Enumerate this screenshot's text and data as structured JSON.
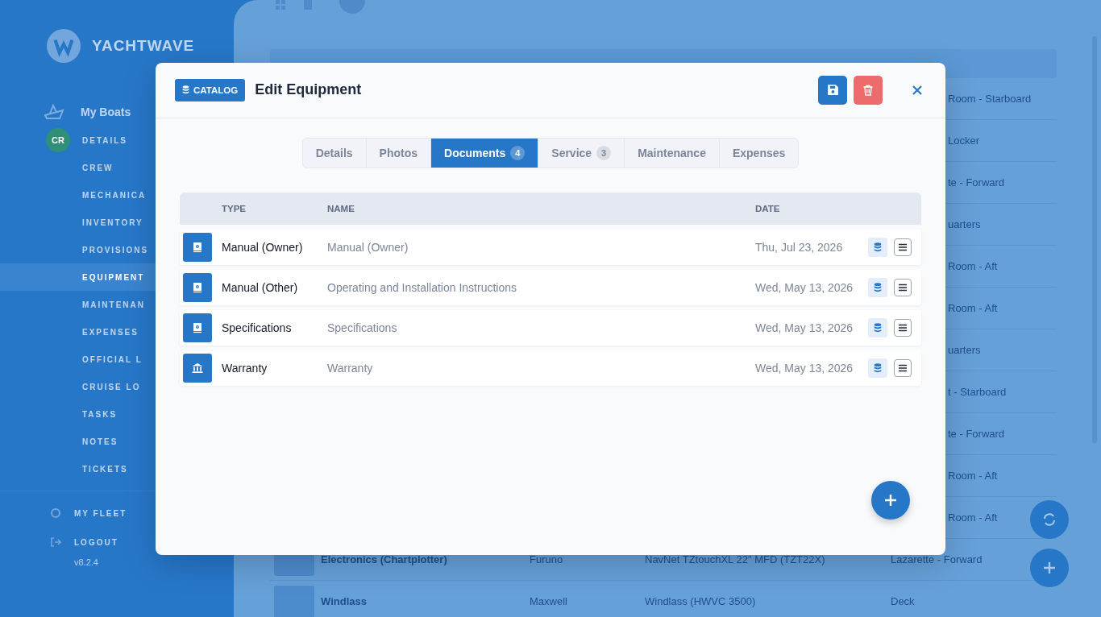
{
  "background": {
    "brand": "YACHTWAVE",
    "sidebar": {
      "boats_label": "My Boats",
      "avatar_initials": "CR",
      "items": [
        {
          "label": "DETAILS",
          "selected": false
        },
        {
          "label": "CREW",
          "selected": false
        },
        {
          "label": "MECHANICA",
          "selected": false
        },
        {
          "label": "INVENTORY",
          "selected": false
        },
        {
          "label": "PROVISIONS",
          "selected": false
        },
        {
          "label": "EQUIPMENT",
          "selected": true
        },
        {
          "label": "MAINTENAN",
          "selected": false
        },
        {
          "label": "EXPENSES",
          "selected": false
        },
        {
          "label": "OFFICIAL L",
          "selected": false
        },
        {
          "label": "CRUISE LO",
          "selected": false
        },
        {
          "label": "TASKS",
          "selected": false
        },
        {
          "label": "NOTES",
          "selected": false
        },
        {
          "label": "TICKETS",
          "selected": false
        }
      ],
      "fleet": "MY FLEET",
      "logout": "LOGOUT",
      "version": "v8.2.4"
    },
    "table": {
      "fragments": [
        "Room - Starboard",
        "Locker",
        "te - Forward",
        "uarters",
        "Room - Aft",
        "Room - Aft",
        "uarters",
        "t - Starboard",
        "te - Forward",
        "Room - Aft",
        "Room - Aft"
      ],
      "rows": [
        {
          "name": "Electronics (Chartplotter)",
          "brand": "Furuno",
          "model": "NavNet TZtouchXL 22\" MFD (TZT22X)",
          "location": "Lazarette - Forward"
        },
        {
          "name": "Windlass",
          "brand": "Maxwell",
          "model": "Windlass (HWVC 3500)",
          "location": "Deck"
        }
      ]
    }
  },
  "modal": {
    "badge": "CATALOG",
    "title": "Edit Equipment",
    "tabs": [
      {
        "label": "Details",
        "selected": false
      },
      {
        "label": "Photos",
        "selected": false
      },
      {
        "label": "Documents",
        "count": "4",
        "selected": true
      },
      {
        "label": "Service",
        "count": "3",
        "selected": false
      },
      {
        "label": "Maintenance",
        "selected": false
      },
      {
        "label": "Expenses",
        "selected": false
      }
    ],
    "columns": [
      "TYPE",
      "NAME",
      "DATE"
    ],
    "rows": [
      {
        "kind": "manual",
        "type": "Manual (Owner)",
        "name": "Manual (Owner)",
        "date": "Thu, Jul 23, 2026"
      },
      {
        "kind": "manual",
        "type": "Manual (Other)",
        "name": "Operating and Installation Instructions",
        "date": "Wed, May 13, 2026"
      },
      {
        "kind": "manual",
        "type": "Specifications",
        "name": "Specifications",
        "date": "Wed, May 13, 2026"
      },
      {
        "kind": "warranty",
        "type": "Warranty",
        "name": "Warranty",
        "date": "Wed, May 13, 2026"
      }
    ]
  }
}
